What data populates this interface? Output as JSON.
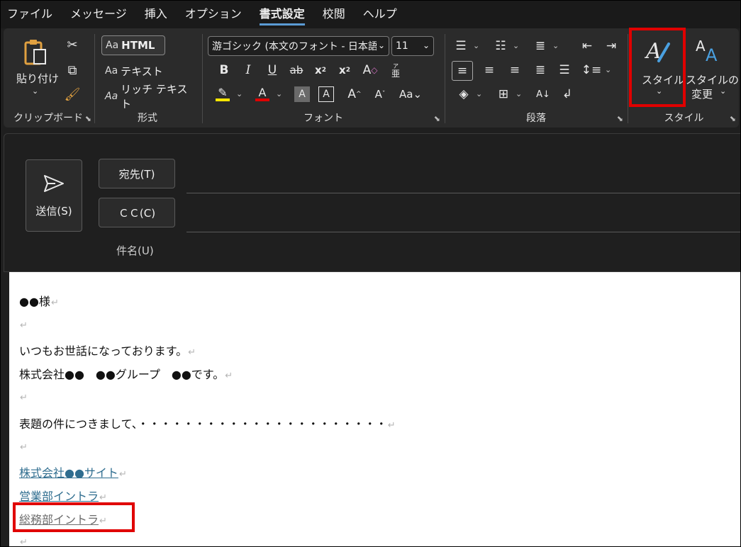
{
  "menu": {
    "items": [
      "ファイル",
      "メッセージ",
      "挿入",
      "オプション",
      "書式設定",
      "校閲",
      "ヘルプ"
    ],
    "active": "書式設定"
  },
  "ribbon": {
    "clipboard": {
      "paste_label": "貼り付け",
      "group_label": "クリップボード"
    },
    "format": {
      "html_label": "HTML",
      "text_label": "テキスト",
      "rich_label": "リッチ テキスト",
      "aa": "Aa",
      "group_label": "形式"
    },
    "font": {
      "font_name": "游ゴシック (本文のフォント - 日本語",
      "font_size": "11",
      "group_label": "フォント"
    },
    "paragraph": {
      "group_label": "段落"
    },
    "styles": {
      "style_label": "スタイル",
      "change_style_label_1": "スタイルの",
      "change_style_label_2": "変更",
      "group_label": "スタイル"
    }
  },
  "compose": {
    "send_label": "送信(S)",
    "to_label": "宛先(T)",
    "cc_label": "ＣＣ(C)",
    "subject_label": "件名(U)"
  },
  "body": {
    "greeting": "●●様",
    "line_intro": "いつもお世話になっております。",
    "line_company": "株式会社●●　●●グループ　●●です。",
    "line_topic": "表題の件につきまして、・・・・・・・・・・・・・・・・・・・・・・",
    "link_site": "株式会社●●サイト",
    "link_sales": "営業部イントラ",
    "link_general": "総務部イントラ",
    "para_mark": "↵"
  },
  "colors": {
    "highlight_annotation": "#e00000",
    "link": "#2f6d8f",
    "visited_link": "#6b6b6b",
    "accent": "#5b9bd5"
  }
}
